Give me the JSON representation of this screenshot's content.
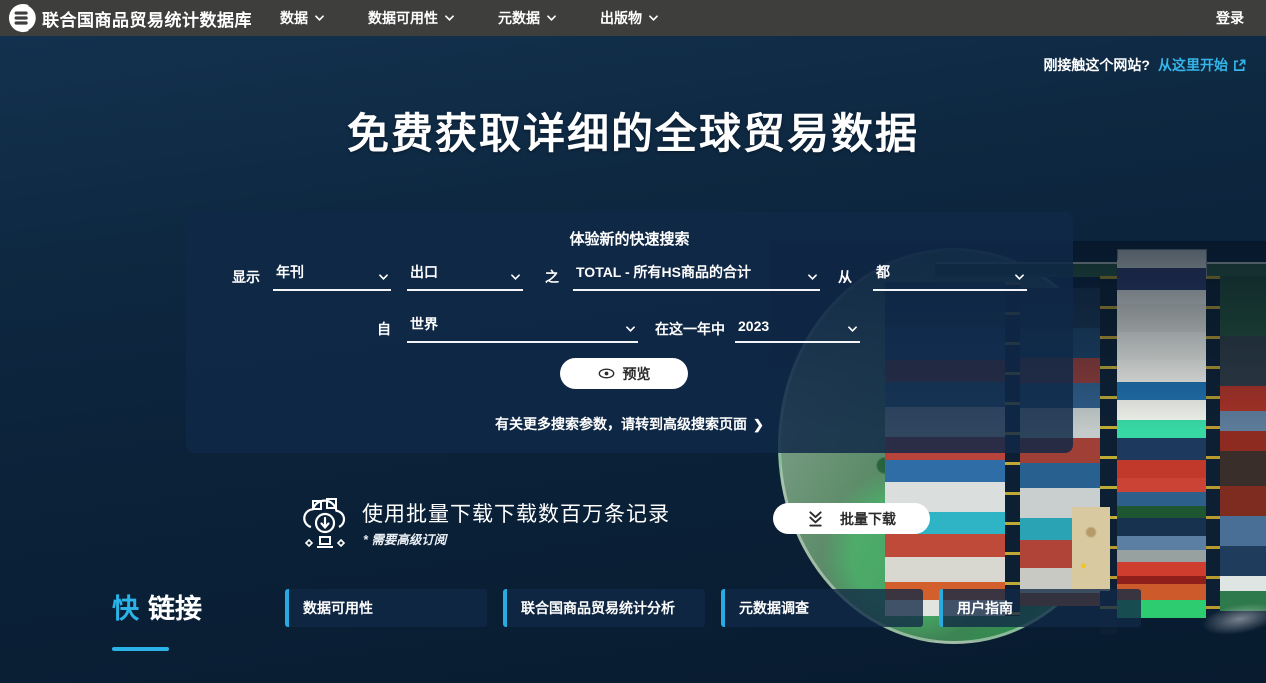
{
  "navbar": {
    "title": "联合国商品贸易统计数据库",
    "menu": [
      {
        "label": "数据"
      },
      {
        "label": "数据可用性"
      },
      {
        "label": "元数据"
      },
      {
        "label": "出版物"
      }
    ],
    "login_label": "登录"
  },
  "hero": {
    "new_site_prompt": "刚接触这个网站?",
    "start_here_link": "从这里开始",
    "heading": "免费获取详细的全球贸易数据"
  },
  "search_panel": {
    "title": "体验新的快速搜索",
    "row1": {
      "show_label": "显示",
      "frequency_value": "年刊",
      "flow_value": "出口",
      "of_label": "之",
      "commodity_value": "TOTAL - 所有HS商品的合计",
      "from_label": "从",
      "reporter_value": "都"
    },
    "row2": {
      "to_label": "自",
      "partner_value": "世界",
      "year_label": "在这一年中",
      "year_value": "2023"
    },
    "preview_button": "预览",
    "advanced_link": "有关更多搜索参数，请转到高级搜索页面",
    "advanced_arrow": "❯"
  },
  "bulk_download": {
    "text": "使用批量下载下载数百万条记录",
    "note": "* 需要高级订阅",
    "button": "批量下载"
  },
  "quick_links": {
    "title_highlight": "快",
    "title_rest": "链接",
    "items": [
      {
        "label": "数据可用性"
      },
      {
        "label": "联合国商品贸易统计分析"
      },
      {
        "label": "元数据调查"
      },
      {
        "label": "用户指南"
      }
    ]
  },
  "colors": {
    "accent_cyan": "#29abe2",
    "link_blue": "#35b5ea",
    "navbar_bg": "#3e3e3d",
    "panel_bg": "rgba(15,41,72,0.84)",
    "ocean_dark": "#0b2239"
  }
}
